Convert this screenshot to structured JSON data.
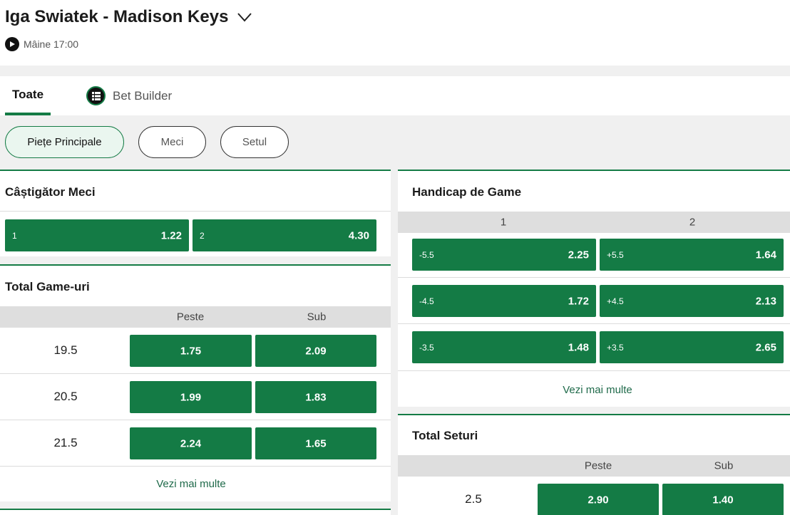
{
  "event": {
    "title": "Iga Swiatek - Madison Keys",
    "time": "Mâine 17:00"
  },
  "tabs": [
    {
      "label": "Toate"
    },
    {
      "label": "Bet Builder"
    }
  ],
  "filters": [
    {
      "label": "Piețe Principale"
    },
    {
      "label": "Meci"
    },
    {
      "label": "Setul"
    }
  ],
  "winner": {
    "title": "Câștigător Meci",
    "options": [
      {
        "label": "1",
        "odd": "1.22"
      },
      {
        "label": "2",
        "odd": "4.30"
      }
    ]
  },
  "total_games": {
    "title": "Total Game-uri",
    "over_label": "Peste",
    "under_label": "Sub",
    "rows": [
      {
        "line": "19.5",
        "over": "1.75",
        "under": "2.09"
      },
      {
        "line": "20.5",
        "over": "1.99",
        "under": "1.83"
      },
      {
        "line": "21.5",
        "over": "2.24",
        "under": "1.65"
      }
    ],
    "more": "Vezi mai multe"
  },
  "handicap": {
    "title": "Handicap de Game",
    "col1": "1",
    "col2": "2",
    "rows": [
      {
        "h1": "-5.5",
        "o1": "2.25",
        "h2": "+5.5",
        "o2": "1.64"
      },
      {
        "h1": "-4.5",
        "o1": "1.72",
        "h2": "+4.5",
        "o2": "2.13"
      },
      {
        "h1": "-3.5",
        "o1": "1.48",
        "h2": "+3.5",
        "o2": "2.65"
      }
    ],
    "more": "Vezi mai multe"
  },
  "total_sets": {
    "title": "Total Seturi",
    "over_label": "Peste",
    "under_label": "Sub",
    "rows": [
      {
        "line": "2.5",
        "over": "2.90",
        "under": "1.40"
      }
    ]
  },
  "colors": {
    "accent": "#147b45",
    "header_gray": "#dedede"
  }
}
